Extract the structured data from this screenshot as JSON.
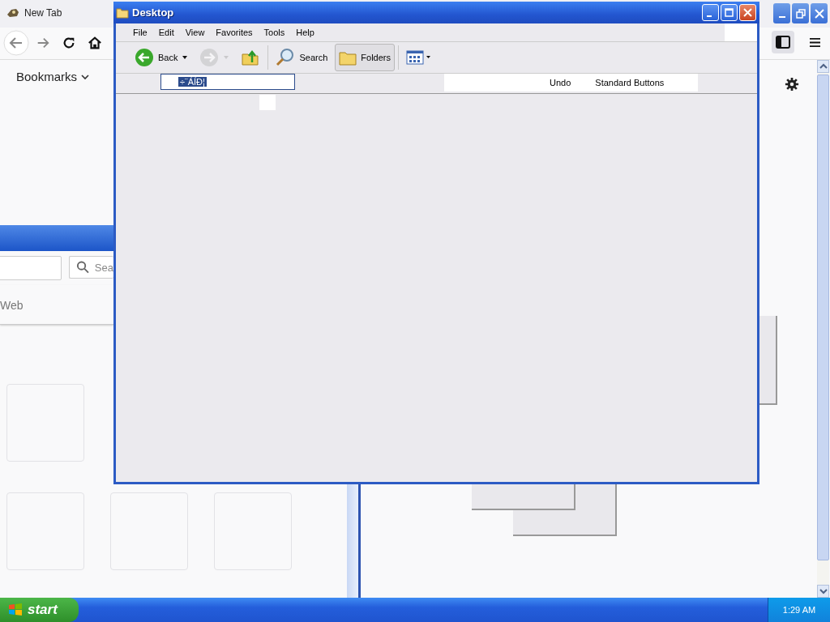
{
  "browser": {
    "tab": {
      "title": "New Tab"
    },
    "bookmarks": {
      "label": "Bookmarks"
    }
  },
  "back_window": {
    "search": {
      "placeholder": "Sea"
    },
    "nav_label": "Web",
    "tiles": [
      {
        "kind": "empty"
      },
      {
        "kind": "empty"
      },
      {
        "kind": "empty"
      },
      {
        "kind": "empty"
      }
    ]
  },
  "explorer": {
    "title": "Desktop",
    "menu": [
      "File",
      "Edit",
      "View",
      "Favorites",
      "Tools",
      "Help"
    ],
    "toolbar": [
      {
        "kind": "back",
        "label": "Back",
        "disabled": false,
        "selected": false
      },
      {
        "kind": "forward",
        "disabled": true,
        "selected": false
      },
      {
        "kind": "up",
        "disabled": false,
        "selected": false
      },
      {
        "kind": "search",
        "label": "Search",
        "disabled": false,
        "selected": false
      },
      {
        "kind": "folders",
        "label": "Folders",
        "disabled": false,
        "selected": true
      },
      {
        "kind": "views",
        "disabled": false,
        "selected": false
      }
    ],
    "address": {
      "value": "÷¨ÁÍÐ¦",
      "selected": true
    },
    "fragments": [
      "Undo",
      "Standard Buttons"
    ]
  },
  "taskbar": {
    "start": "start",
    "clock": "1:29 AM"
  }
}
